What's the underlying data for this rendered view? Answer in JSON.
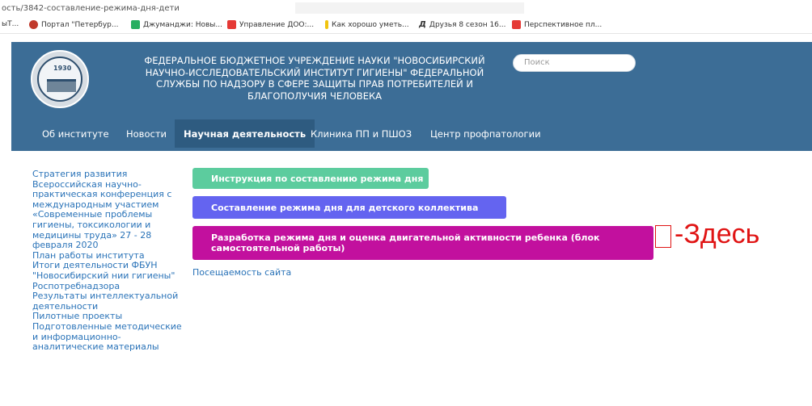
{
  "browser": {
    "url": "ость/3842-составление-режима-дня-дети",
    "bookmarks": [
      {
        "label": "ыТ...",
        "color": ""
      },
      {
        "label": "Портал \"Петербур...",
        "color": "#c0392b"
      },
      {
        "label": "Джуманджи: Новы...",
        "color": "#27ae60"
      },
      {
        "label": "Управление ДОО:...",
        "color": "#e53935"
      },
      {
        "label": "Как хорошо уметь...",
        "color": "#f1c40f"
      },
      {
        "label": "Друзья 8 сезон 16...",
        "color": "#333333"
      },
      {
        "label": "Перспективное пл...",
        "color": "#e53935"
      }
    ]
  },
  "header": {
    "logo_year": "1930",
    "org_title": "ФЕДЕРАЛЬНОЕ БЮДЖЕТНОЕ УЧРЕЖДЕНИЕ НАУКИ \"НОВОСИБИРСКИЙ НАУЧНО-ИССЛЕДОВАТЕЛЬСКИЙ ИНСТИТУТ ГИГИЕНЫ\" ФЕДЕРАЛЬНОЙ СЛУЖБЫ ПО НАДЗОРУ В СФЕРЕ ЗАЩИТЫ ПРАВ ПОТРЕБИТЕЛЕЙ И БЛАГОПОЛУЧИЯ ЧЕЛОВЕКА",
    "search_placeholder": "Поиск",
    "bg_color": "#3c6d96"
  },
  "nav": [
    {
      "label": "Об институте"
    },
    {
      "label": "Новости"
    },
    {
      "label": "Научная деятельность",
      "active": true
    },
    {
      "label": "Клиника ПП и ПШОЗ"
    },
    {
      "label": "Центр профпатологии"
    }
  ],
  "sidebar": [
    "Стратегия развития",
    "Всероссийская научно-практическая конференция с международным участием «Современные проблемы гигиены, токсикологии и медицины труда» 27 - 28 февраля 2020",
    "План работы института",
    "Итоги деятельности ФБУН \"Новосибирский нии гигиены\" Роспотребнадзора",
    "Результаты интеллектуальной деятельности",
    "Пилотные проекты",
    "Подготовленные методические и информационно-аналитические материалы"
  ],
  "buttons": {
    "instruction": "Инструкция по составлению режима дня",
    "collective": "Составление режима дня для детского коллектива",
    "development": "Разработка режима дня и оценка двигательной активности ребенка (блок самостоятельной работы)"
  },
  "visits_link": "Посещаемость сайта",
  "annotation": "-Здесь"
}
